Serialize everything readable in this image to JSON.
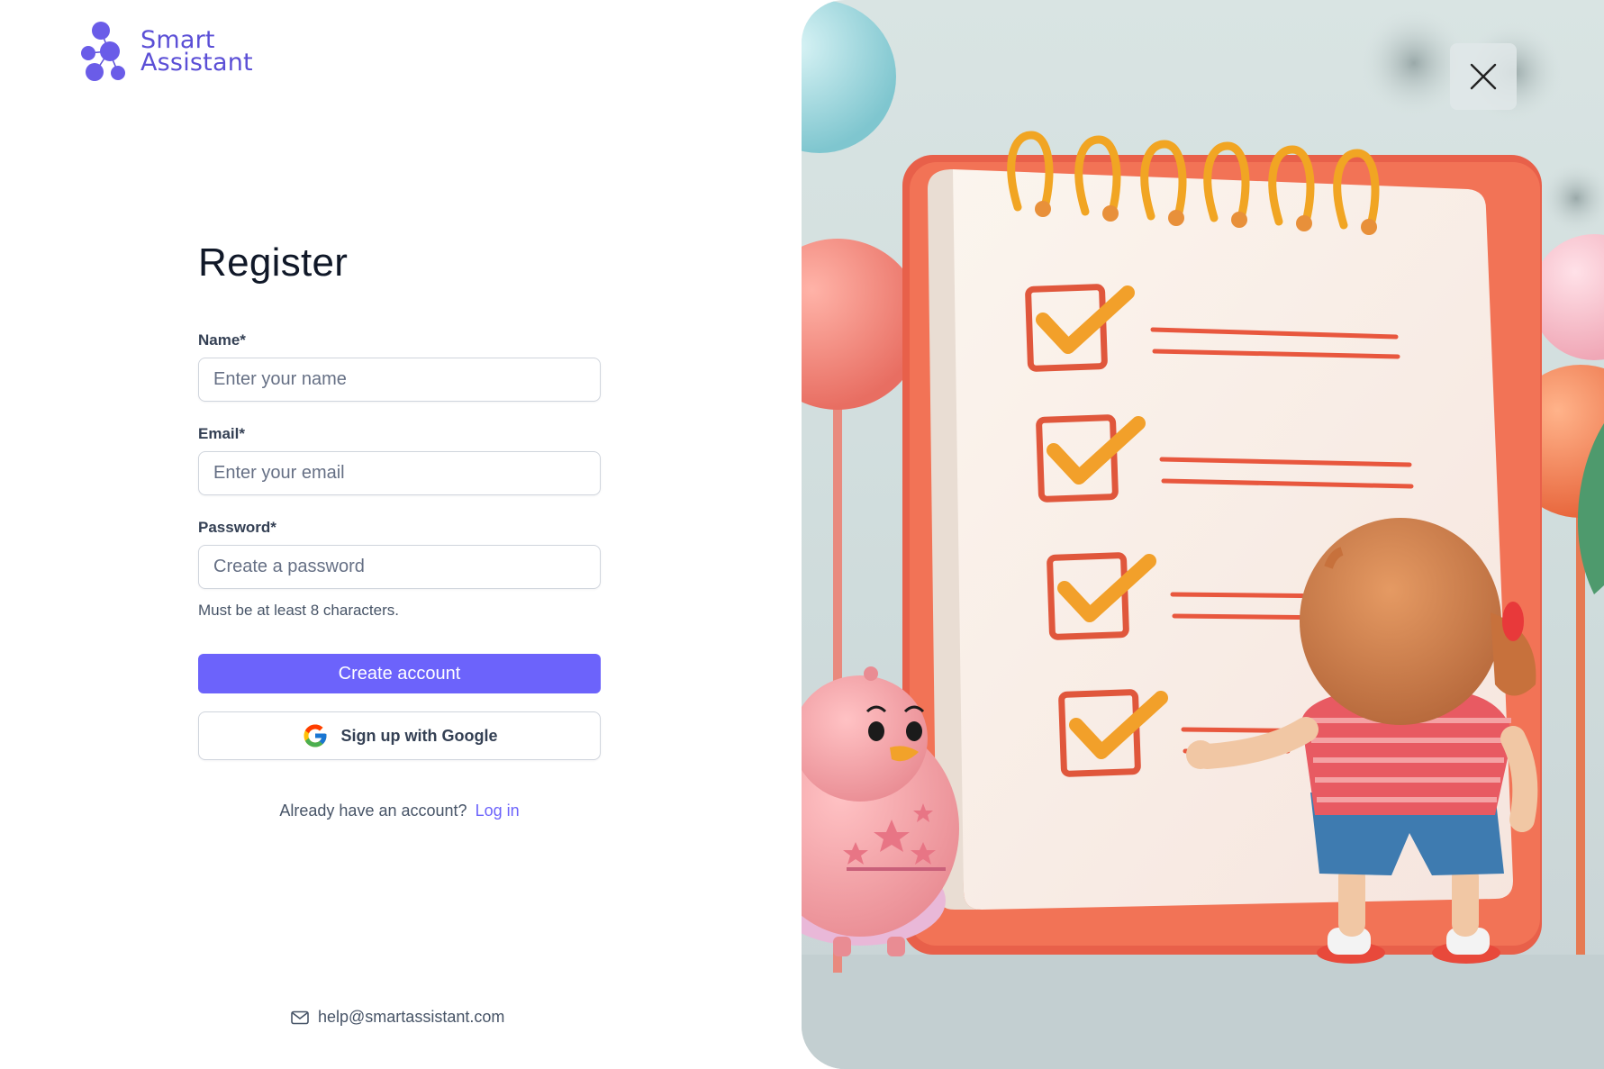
{
  "brand": {
    "name_line1": "Smart",
    "name_line2": "Assistant",
    "accent_color": "#6c63fb",
    "logo_icon": "molecule-dots-icon"
  },
  "form": {
    "title": "Register",
    "name_label": "Name*",
    "name_placeholder": "Enter your name",
    "name_value": "",
    "email_label": "Email*",
    "email_placeholder": "Enter your email",
    "email_value": "",
    "password_label": "Password*",
    "password_placeholder": "Create a password",
    "password_value": "",
    "password_hint": "Must be at least 8 characters.",
    "create_button": "Create account",
    "google_button": "Sign up with Google",
    "google_icon": "google-g-icon"
  },
  "login": {
    "prompt": "Already have an account?",
    "link": "Log in"
  },
  "footer": {
    "help_icon": "mail-icon",
    "help_email": "help@smartassistant.com"
  },
  "hero": {
    "close_icon": "close-icon",
    "illustration": "girl-checking-checklist-notepad"
  }
}
